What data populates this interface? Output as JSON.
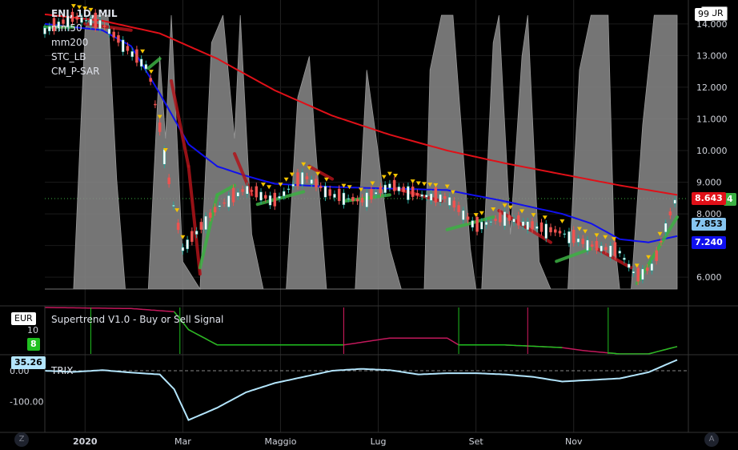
{
  "legend": {
    "symbol": "ENI, 1D, MIL",
    "ind1": "mm50",
    "ind2": "mm200",
    "ind3": "STC_LB",
    "ind4": "CM_P-SAR"
  },
  "currency": "EUR",
  "supertrend_title": "Supertrend V1.0 - Buy or Sell Signal",
  "trix_title": "TRIX",
  "badges": {
    "mm200": "8.643",
    "close": "7.853",
    "mm50": "7.240",
    "supertrend": "8",
    "trix": "35.26",
    "top_cut": "99",
    "close_cut": "4"
  },
  "controls": {
    "zoom": "Z",
    "auto": "A"
  },
  "colors": {
    "mm50": "#1010ee",
    "mm200": "#e01018",
    "stc_area": "#8a8a8a",
    "psar": "#f5c400",
    "up": "#3cb043",
    "down": "#d81b60",
    "trix": "#b3e5fc"
  },
  "chart_data": [
    {
      "type": "line",
      "name": "price_panel",
      "title": "ENI, 1D, MIL",
      "ylim": [
        5.6,
        14.4
      ],
      "yticks": [
        "14.000",
        "13.000",
        "12.000",
        "11.000",
        "10.000",
        "9.000",
        "8.000",
        "7.000",
        "6.000"
      ],
      "x_labels": [
        "2020",
        "Mar",
        "Maggio",
        "Lug",
        "Set",
        "Nov"
      ],
      "series": [
        {
          "name": "mm200",
          "x": [
            0,
            20,
            40,
            60,
            80,
            100,
            120,
            140,
            160,
            180,
            200,
            220
          ],
          "values": [
            14.3,
            14.1,
            13.7,
            12.9,
            11.9,
            11.1,
            10.5,
            10.0,
            9.6,
            9.25,
            8.9,
            8.6
          ]
        },
        {
          "name": "mm50",
          "x": [
            0,
            20,
            30,
            40,
            50,
            60,
            70,
            80,
            100,
            120,
            140,
            160,
            180,
            190,
            200,
            210,
            220
          ],
          "values": [
            14.0,
            13.8,
            13.3,
            11.8,
            10.2,
            9.5,
            9.2,
            8.95,
            8.85,
            8.8,
            8.75,
            8.4,
            8.0,
            7.7,
            7.2,
            7.1,
            7.3
          ]
        },
        {
          "name": "price",
          "x": [
            0,
            10,
            20,
            30,
            36,
            40,
            44,
            48,
            60,
            70,
            80,
            90,
            100,
            110,
            120,
            130,
            140,
            150,
            160,
            170,
            180,
            190,
            200,
            206,
            212,
            216,
            220
          ],
          "values": [
            13.8,
            14.2,
            14.0,
            13.1,
            12.6,
            10.7,
            8.6,
            6.9,
            8.2,
            8.8,
            8.4,
            9.2,
            8.6,
            8.4,
            8.9,
            8.6,
            8.5,
            7.6,
            7.9,
            7.6,
            7.4,
            7.0,
            6.8,
            6.0,
            6.4,
            7.6,
            8.6
          ]
        }
      ]
    },
    {
      "type": "line",
      "name": "supertrend_panel",
      "title": "Supertrend V1.0 - Buy or Sell Signal",
      "yticks": [
        "10"
      ],
      "series": [
        {
          "name": "supertrend",
          "x": [
            0,
            30,
            45,
            50,
            60,
            80,
            104,
            120,
            140,
            144,
            160,
            180,
            188,
            200,
            210,
            220
          ],
          "values": [
            14.4,
            14.2,
            13.6,
            10.2,
            7.3,
            7.3,
            7.3,
            8.6,
            8.6,
            7.3,
            7.3,
            6.8,
            6.2,
            5.6,
            5.6,
            7.0
          ]
        }
      ]
    },
    {
      "type": "line",
      "name": "trix_panel",
      "title": "TRIX",
      "ylim": [
        -180,
        40
      ],
      "yticks": [
        "0.00",
        "-100.00"
      ],
      "series": [
        {
          "name": "TRIX",
          "x": [
            0,
            10,
            20,
            30,
            40,
            45,
            50,
            60,
            70,
            80,
            90,
            100,
            110,
            120,
            130,
            140,
            150,
            160,
            170,
            180,
            190,
            200,
            210,
            220
          ],
          "values": [
            0,
            -4,
            2,
            -6,
            -12,
            -60,
            -160,
            -120,
            -70,
            -40,
            -20,
            0,
            6,
            2,
            -12,
            -8,
            -8,
            -12,
            -20,
            -35,
            -30,
            -25,
            -5,
            35.26
          ]
        }
      ]
    }
  ]
}
